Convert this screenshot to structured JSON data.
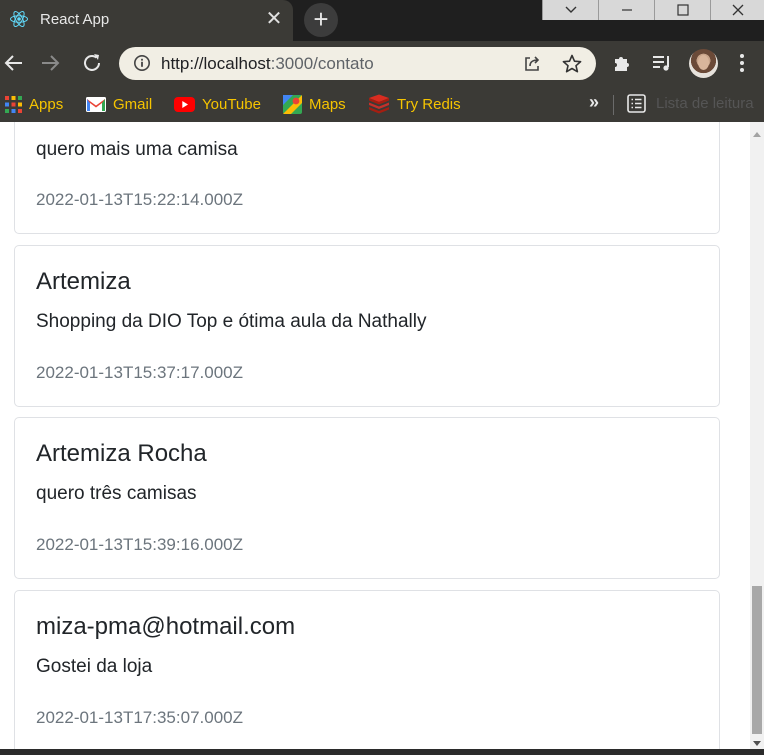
{
  "tab": {
    "title": "React App",
    "close_glyph": "✕",
    "new_tab_glyph": "+"
  },
  "address_bar": {
    "url_host": "http://localhost",
    "url_path": ":3000/contato"
  },
  "bookmarks": {
    "items": [
      {
        "label": "Apps",
        "icon": "apps-grid-icon"
      },
      {
        "label": "Gmail",
        "icon": "gmail-icon"
      },
      {
        "label": "YouTube",
        "icon": "youtube-icon"
      },
      {
        "label": "Maps",
        "icon": "maps-icon"
      },
      {
        "label": "Try Redis",
        "icon": "redis-icon"
      }
    ],
    "more_glyph": "»",
    "reading_list": "Lista de leitura"
  },
  "messages": [
    {
      "name": "",
      "text": "quero mais uma camisa",
      "date": "2022-01-13T15:22:14.000Z"
    },
    {
      "name": "Artemiza",
      "text": "Shopping da DIO Top e ótima aula da Nathally",
      "date": "2022-01-13T15:37:17.000Z"
    },
    {
      "name": "Artemiza Rocha",
      "text": "quero três camisas",
      "date": "2022-01-13T15:39:16.000Z"
    },
    {
      "name": "miza-pma@hotmail.com",
      "text": "Gostei da loja",
      "date": "2022-01-13T17:35:07.000Z"
    }
  ],
  "colors": {
    "toolbar": "#3b3a36",
    "bookmark_text": "#f6c400",
    "card_border": "#dfe1e5",
    "date_text": "#6c757d"
  }
}
